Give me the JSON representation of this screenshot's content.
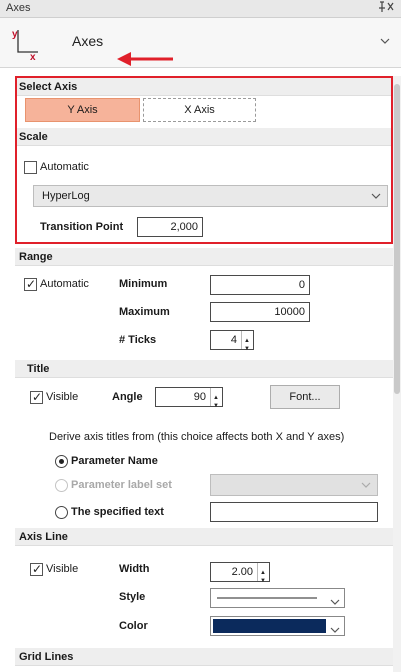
{
  "titlebar": {
    "title": "Axes",
    "pin_glyph": "❙ ✕"
  },
  "toolbar": {
    "axes_label": "Axes",
    "icon_y": "y",
    "icon_x": "x"
  },
  "select_axis": {
    "header": "Select Axis",
    "tabs": [
      {
        "label": "Y Axis",
        "active": true
      },
      {
        "label": "X Axis",
        "active": false
      }
    ]
  },
  "scale": {
    "header": "Scale",
    "automatic_label": "Automatic",
    "automatic_checked": false,
    "type_value": "HyperLog",
    "transition_label": "Transition Point",
    "transition_value": "2,000"
  },
  "range": {
    "header": "Range",
    "automatic_label": "Automatic",
    "automatic_checked": true,
    "minimum_label": "Minimum",
    "minimum_value": "0",
    "maximum_label": "Maximum",
    "maximum_value": "10000",
    "ticks_label": "# Ticks",
    "ticks_value": "4"
  },
  "title": {
    "header": "Title",
    "visible_label": "Visible",
    "visible_checked": true,
    "angle_label": "Angle",
    "angle_value": "90",
    "font_button": "Font...",
    "derive_text": "Derive axis titles from (this choice affects both X and Y axes)",
    "options": [
      {
        "label": "Parameter Name",
        "selected": true,
        "enabled": true
      },
      {
        "label": "Parameter label set",
        "selected": false,
        "enabled": false
      },
      {
        "label": "The specified text",
        "selected": false,
        "enabled": true
      }
    ],
    "specified_text_value": ""
  },
  "axis_line": {
    "header": "Axis Line",
    "visible_label": "Visible",
    "visible_checked": true,
    "width_label": "Width",
    "width_value": "2.00",
    "style_label": "Style",
    "color_label": "Color",
    "color_hex": "#0b2a5c"
  },
  "grid_lines": {
    "header": "Grid Lines"
  },
  "colors": {
    "highlight": "#e0202a",
    "active_tab": "#f6b39a"
  }
}
